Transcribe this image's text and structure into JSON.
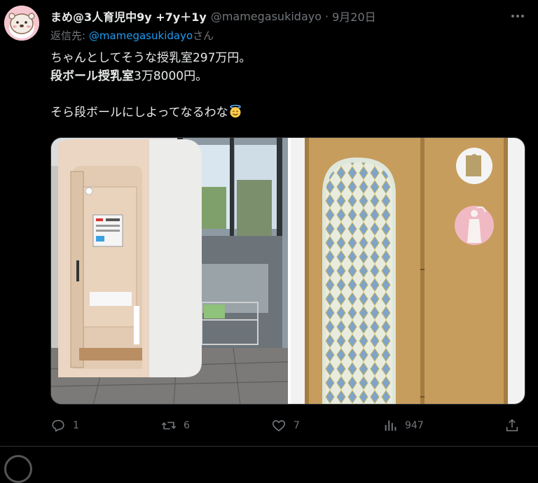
{
  "tweet": {
    "display_name": "まめ@3人育児中9y +7y＋1y",
    "handle": "@mamegasukidayo",
    "separator": "·",
    "date": "9月20日",
    "reply_prefix": "返信先: ",
    "reply_mention": "@mamegasukidayo",
    "reply_suffix": "さん",
    "text": {
      "line1": "ちゃんとしてそうな授乳室297万円。",
      "line2_bold": "段ボール授乳室",
      "line2_rest": "3万8000円。",
      "line3": "",
      "line4": "そら段ボールにしよってなるわな",
      "line4_emoji": "smiling-face-with-halo-emoji"
    },
    "media": {
      "image1": "photo of a white and light-wood nursing booth with sliding door in a building lobby",
      "image2": "photo of a cardboard nursing room with a patterned curtain and pink/white icon signs"
    },
    "actions": {
      "reply_icon": "reply-icon",
      "reply_count": "1",
      "retweet_icon": "retweet-icon",
      "retweet_count": "6",
      "like_icon": "like-icon",
      "like_count": "7",
      "views_icon": "views-icon",
      "views_count": "947",
      "share_icon": "share-icon"
    }
  },
  "colors": {
    "background": "#000000",
    "text": "#e7e9ea",
    "muted": "#71767b",
    "link": "#1d9bf0",
    "border": "#2f3336"
  }
}
